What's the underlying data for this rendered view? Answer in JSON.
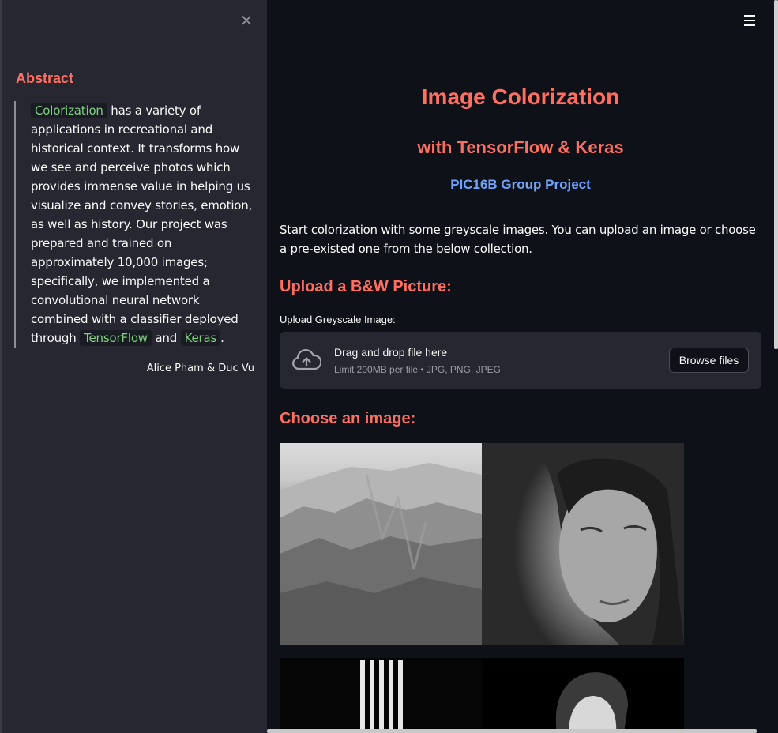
{
  "sidebar": {
    "close_icon": "close-icon",
    "abstract_title": "Abstract",
    "abstract": {
      "code1": "Colorization",
      "part1": " has a variety of applications in recreational and historical context. It transforms how we see and perceive photos which provides immense value in helping us visualize and convey stories, emotion, as well as history. Our project was prepared and trained on approximately 10,000 images; specifically, we implemented a convolutional neural network combined with a classifier deployed through ",
      "code2": "TensorFlow",
      "part2": " and ",
      "code3": "Keras",
      "part3": "."
    },
    "authors": "Alice Pham & Duc Vu"
  },
  "header": {
    "menu_icon": "hamburger-menu-icon"
  },
  "main": {
    "title": "Image Colorization",
    "subtitle": "with TensorFlow & Keras",
    "project": "PIC16B Group Project",
    "intro": "Start colorization with some greyscale images. You can upload an image or choose a pre-existed one from the below collection.",
    "upload_heading": "Upload a B&W Picture:",
    "upload_label": "Upload Greyscale Image:",
    "dropzone": {
      "icon": "cloud-upload-icon",
      "main": "Drag and drop file here",
      "sub": "Limit 200MB per file • JPG, PNG, JPEG",
      "button": "Browse files"
    },
    "choose_heading": "Choose an image:"
  },
  "colors": {
    "accent": "#ff6f61",
    "link": "#6fa4ff",
    "code": "#7fd17f",
    "background": "#0e1117",
    "sidebar": "#262730"
  }
}
